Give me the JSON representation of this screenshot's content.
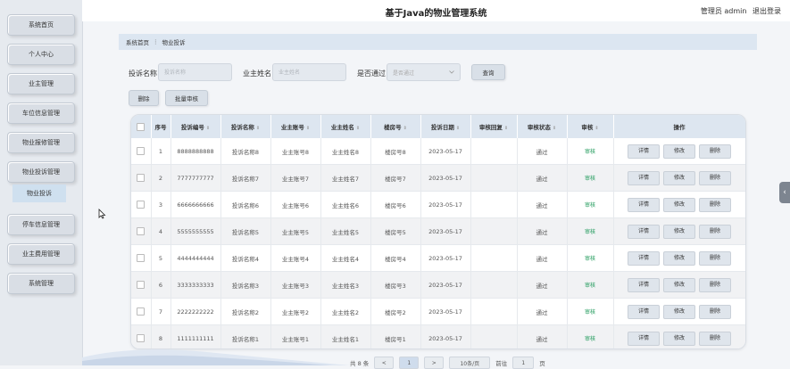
{
  "header": {
    "title": "基于Java的物业管理系统",
    "role": "管理员 admin",
    "logout": "退出登录"
  },
  "sidebar": {
    "items": [
      {
        "label": "系统首页"
      },
      {
        "label": "个人中心"
      },
      {
        "label": "业主管理"
      },
      {
        "label": "车位信息管理"
      },
      {
        "label": "物业报修管理"
      },
      {
        "label": "物业投诉管理"
      },
      {
        "label": "停车信息管理"
      },
      {
        "label": "业主费用管理"
      },
      {
        "label": "系统管理"
      }
    ],
    "sub_item": "物业投诉"
  },
  "breadcrumb": {
    "home": "系统首页",
    "separator": "⋮",
    "current": "物业投诉"
  },
  "search": {
    "name_label": "投诉名称",
    "name_placeholder": "投诉名称",
    "owner_label": "业主姓名",
    "owner_placeholder": "业主姓名",
    "pass_label": "是否通过",
    "pass_placeholder": "是否通过",
    "query_button": "查询"
  },
  "actions": {
    "delete": "删除",
    "batch_audit": "批量审核"
  },
  "table": {
    "columns": [
      "序号",
      "投诉编号",
      "投诉名称",
      "业主账号",
      "业主姓名",
      "楼房号",
      "投诉日期",
      "审核回复",
      "审核状态",
      "审核",
      "操作"
    ],
    "rows": [
      {
        "no": "1",
        "code": "8888888888",
        "name": "投诉名称8",
        "account": "业主账号8",
        "owner": "业主姓名8",
        "room": "楼房号8",
        "date": "2023-05-17",
        "reply": "",
        "status": "通过",
        "audit": "审核"
      },
      {
        "no": "2",
        "code": "7777777777",
        "name": "投诉名称7",
        "account": "业主账号7",
        "owner": "业主姓名7",
        "room": "楼房号7",
        "date": "2023-05-17",
        "reply": "",
        "status": "通过",
        "audit": "审核"
      },
      {
        "no": "3",
        "code": "6666666666",
        "name": "投诉名称6",
        "account": "业主账号6",
        "owner": "业主姓名6",
        "room": "楼房号6",
        "date": "2023-05-17",
        "reply": "",
        "status": "通过",
        "audit": "审核"
      },
      {
        "no": "4",
        "code": "5555555555",
        "name": "投诉名称5",
        "account": "业主账号5",
        "owner": "业主姓名5",
        "room": "楼房号5",
        "date": "2023-05-17",
        "reply": "",
        "status": "通过",
        "audit": "审核"
      },
      {
        "no": "5",
        "code": "4444444444",
        "name": "投诉名称4",
        "account": "业主账号4",
        "owner": "业主姓名4",
        "room": "楼房号4",
        "date": "2023-05-17",
        "reply": "",
        "status": "通过",
        "audit": "审核"
      },
      {
        "no": "6",
        "code": "3333333333",
        "name": "投诉名称3",
        "account": "业主账号3",
        "owner": "业主姓名3",
        "room": "楼房号3",
        "date": "2023-05-17",
        "reply": "",
        "status": "通过",
        "audit": "审核"
      },
      {
        "no": "7",
        "code": "2222222222",
        "name": "投诉名称2",
        "account": "业主账号2",
        "owner": "业主姓名2",
        "room": "楼房号2",
        "date": "2023-05-17",
        "reply": "",
        "status": "通过",
        "audit": "审核"
      },
      {
        "no": "8",
        "code": "1111111111",
        "name": "投诉名称1",
        "account": "业主账号1",
        "owner": "业主姓名1",
        "room": "楼房号1",
        "date": "2023-05-17",
        "reply": "",
        "status": "通过",
        "audit": "审核"
      }
    ],
    "op_labels": {
      "detail": "详情",
      "edit": "修改",
      "delete": "删除"
    }
  },
  "pagination": {
    "total": "共 8 条",
    "prev": "<",
    "page": "1",
    "next": ">",
    "page_size": "10条/页",
    "goto_label": "前往",
    "goto_value": "1",
    "goto_suffix": "页"
  },
  "icons": {
    "cursor": "mouse-pointer-icon",
    "sort": "sort-icon",
    "collapse": "chevron-left-icon"
  },
  "colors": {
    "accent": "#dce6f1",
    "audit_link": "#1f9a5a"
  }
}
